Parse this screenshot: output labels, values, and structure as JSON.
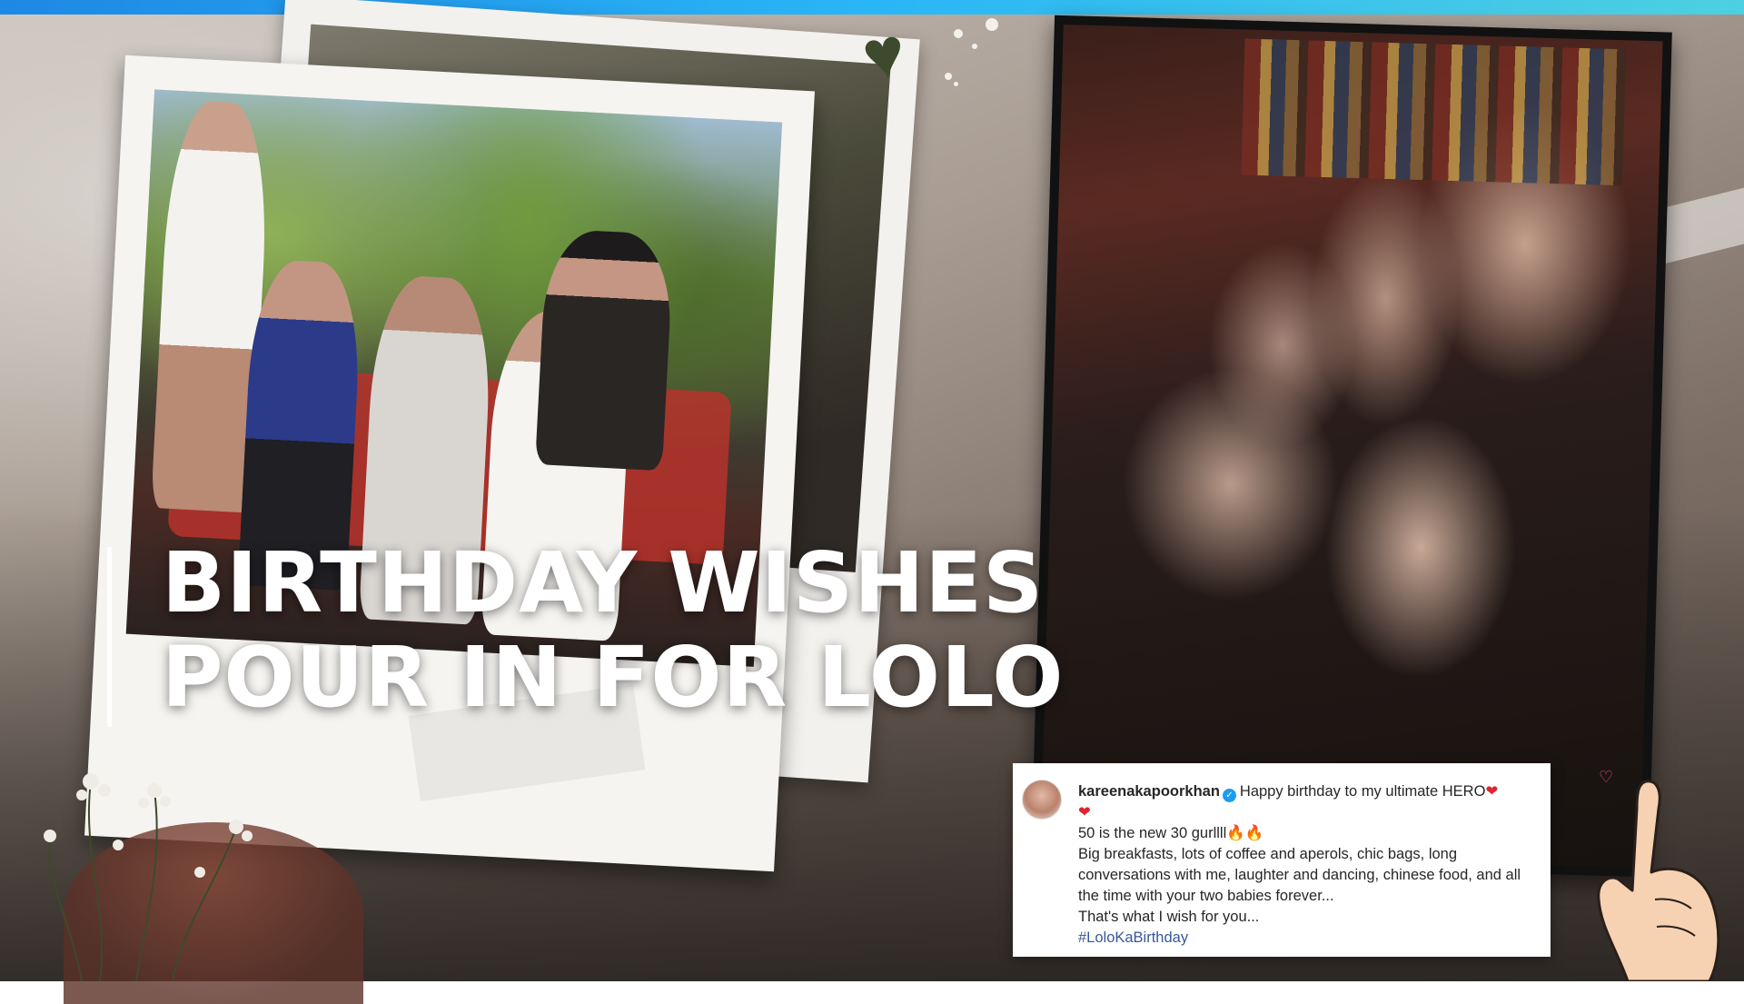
{
  "headline": {
    "line1": "BIRTHDAY WISHES",
    "line2": "POUR IN FOR LOLO"
  },
  "caption": {
    "username": "kareenakapoorkhan",
    "greeting": "Happy birthday to my ultimate HERO",
    "heart": "❤",
    "line2": "50 is the new 30 gurllll",
    "fire": "🔥🔥",
    "line3": "Big breakfasts, lots of coffee and aperols, chic bags, long conversations with me, laughter and dancing, chinese food, and all the time with your two babies forever...",
    "line4": "That's what I wish for you...",
    "hashtag": "#LoloKaBirthday"
  },
  "colors": {
    "accent_bar": "#1e88e5",
    "title_text": "#ffffff",
    "heart": "#e0242f",
    "hashtag": "#385898"
  },
  "icons": [
    "verified-badge-icon",
    "heart-icon",
    "fire-icon",
    "pointing-hand-icon",
    "decorative-heart-icon"
  ]
}
